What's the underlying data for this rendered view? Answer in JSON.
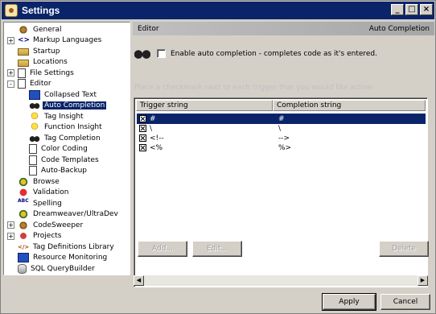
{
  "window": {
    "title": "Settings",
    "buttons": [
      "_",
      "□",
      "×"
    ]
  },
  "tree": [
    {
      "label": "General",
      "icon": "gear-icon"
    },
    {
      "label": "Markup Languages",
      "icon": "code-icon",
      "expander": "+"
    },
    {
      "label": "Startup",
      "icon": "folder-icon"
    },
    {
      "label": "Locations",
      "icon": "folder-icon"
    },
    {
      "label": "File Settings",
      "icon": "document-icon",
      "expander": "+"
    },
    {
      "label": "Editor",
      "icon": "editor-icon",
      "expander": "-"
    },
    {
      "label": "Collapsed Text",
      "icon": "collapse-icon"
    },
    {
      "label": "Auto Completion",
      "icon": "binoculars-icon",
      "selected": true
    },
    {
      "label": "Tag Insight",
      "icon": "bulb-icon"
    },
    {
      "label": "Function Insight",
      "icon": "bulb-icon"
    },
    {
      "label": "Tag Completion",
      "icon": "binoculars-icon"
    },
    {
      "label": "Color Coding",
      "icon": "document-icon"
    },
    {
      "label": "Code Templates",
      "icon": "document-icon"
    },
    {
      "label": "Auto-Backup",
      "icon": "backup-icon"
    },
    {
      "label": "Browse",
      "icon": "globe-icon"
    },
    {
      "label": "Validation",
      "icon": "validation-icon"
    },
    {
      "label": "Spelling",
      "icon": "spelling-icon"
    },
    {
      "label": "Dreamweaver/UltraDev",
      "icon": "dreamweaver-icon"
    },
    {
      "label": "CodeSweeper",
      "icon": "sweeper-icon",
      "expander": "+"
    },
    {
      "label": "Projects",
      "icon": "projects-icon",
      "expander": "+"
    },
    {
      "label": "Tag Definitions Library",
      "icon": "tag-icon"
    },
    {
      "label": "Resource Monitoring",
      "icon": "monitor-icon"
    },
    {
      "label": "SQL QueryBuilder",
      "icon": "database-icon"
    }
  ],
  "panel": {
    "section": "Editor",
    "page": "Auto Completion",
    "enable_label": "Enable auto completion - completes code as it's entered.",
    "hint": "Place a checkmark next to each trigger that you would like active:",
    "columns": [
      "Trigger string",
      "Completion string"
    ],
    "rows": [
      {
        "trigger": "#",
        "completion": "#",
        "checked": true,
        "selected": true
      },
      {
        "trigger": "\\",
        "completion": "\\",
        "checked": true
      },
      {
        "trigger": "<!--",
        "completion": "-->",
        "checked": true
      },
      {
        "trigger": "<%",
        "completion": "%>",
        "checked": true
      }
    ],
    "add_label": "Add...",
    "edit_label": "Edit...",
    "delete_label": "Delete"
  },
  "footer": {
    "apply_label": "Apply",
    "cancel_label": "Cancel"
  }
}
